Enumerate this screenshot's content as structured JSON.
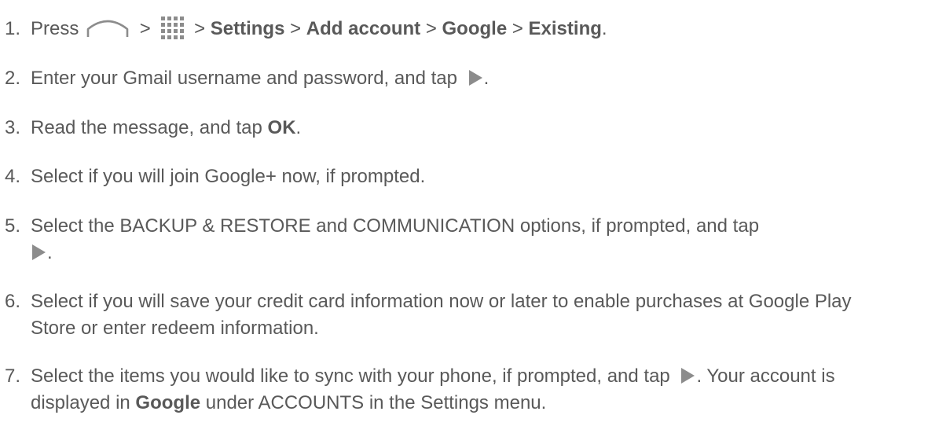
{
  "steps": [
    {
      "number": "1.",
      "press": "Press",
      "sep1": ">",
      "sep2": ">",
      "settings": "Settings",
      "sep3": ">",
      "add_account": "Add account",
      "sep4": ">",
      "google": "Google",
      "sep5": ">",
      "existing": "Existing",
      "end": "."
    },
    {
      "number": "2.",
      "text": "Enter your Gmail username and password, and tap",
      "end": "."
    },
    {
      "number": "3.",
      "text": "Read the message, and tap",
      "ok": "OK",
      "end": "."
    },
    {
      "number": "4.",
      "text": "Select if you will join Google+ now, if prompted."
    },
    {
      "number": "5.",
      "text": "Select the BACKUP & RESTORE and COMMUNICATION options, if prompted, and tap",
      "end": "."
    },
    {
      "number": "6.",
      "text": "Select if you will save your credit card information now or later to enable purchases at Google Play Store or enter redeem information."
    },
    {
      "number": "7.",
      "text_a": "Select the items you would like to sync with your phone, if prompted, and tap",
      "text_b": ". Your account is displayed in",
      "google": "Google",
      "text_c": "under ACCOUNTS in the Settings menu."
    }
  ],
  "icons": {
    "home": "home-key-icon",
    "apps": "apps-grid-icon",
    "next": "next-arrow-icon"
  },
  "colors": {
    "text": "#595959",
    "icon": "#8c8c8c"
  }
}
